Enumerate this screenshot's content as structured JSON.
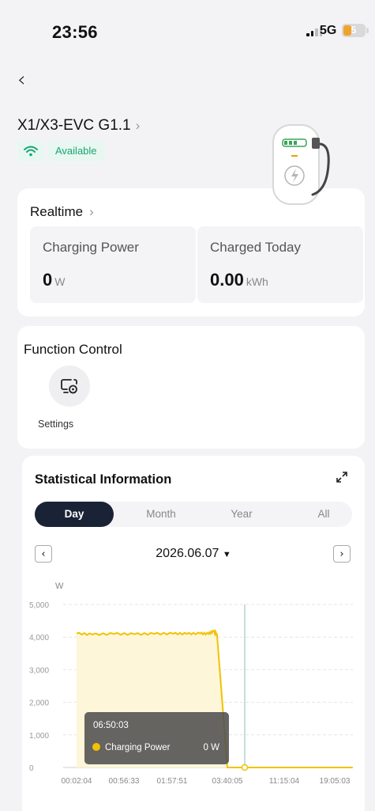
{
  "status_bar": {
    "time": "23:56",
    "network": "5G",
    "battery": "5"
  },
  "header": {
    "back": "‹",
    "device_name": "X1/X3-EVC G1.1",
    "chevron": "›",
    "status": "Available"
  },
  "realtime": {
    "title": "Realtime",
    "chevron": "›",
    "charging_power": {
      "label": "Charging Power",
      "value": "0",
      "unit": "W"
    },
    "charged_today": {
      "label": "Charged Today",
      "value": "0.00",
      "unit": "kWh"
    }
  },
  "function_control": {
    "title": "Function Control",
    "settings_label": "Settings"
  },
  "statistics": {
    "title": "Statistical Information",
    "tabs": [
      "Day",
      "Month",
      "Year",
      "All"
    ],
    "active_tab": "Day",
    "date": "2026.06.07",
    "prev": "‹",
    "next": "›"
  },
  "tooltip": {
    "time": "06:50:03",
    "series": "Charging Power",
    "value": "0 W"
  },
  "chart_data": {
    "type": "area",
    "ylabel": "W",
    "ylim": [
      0,
      5000
    ],
    "y_ticks": [
      "0",
      "1,000",
      "2,000",
      "3,000",
      "4,000",
      "5,000"
    ],
    "x_tick_labels": [
      "00:02:04",
      "00:56:33",
      "01:57:51",
      "03:40:05",
      "11:15:04",
      "19:05:03"
    ],
    "series": [
      {
        "name": "Charging Power",
        "color": "#f2c200",
        "x": [
          "00:02:04",
          "00:20:00",
          "00:45:00",
          "01:10:00",
          "01:35:00",
          "02:00:00",
          "02:25:00",
          "02:50:00",
          "03:05:00",
          "03:15:00",
          "03:20:00",
          "03:21:00",
          "03:40:05",
          "06:50:03",
          "11:15:04",
          "19:05:03",
          "23:56:00"
        ],
        "values": [
          4110,
          4080,
          4100,
          4090,
          4100,
          4105,
          4100,
          4110,
          4100,
          4180,
          4080,
          4070,
          0,
          0,
          0,
          0,
          0
        ]
      }
    ],
    "grid": true,
    "marker_time": "06:50:03"
  },
  "colors": {
    "accent": "#f2c200",
    "available": "#17a572",
    "segment_active": "#1a2236"
  }
}
